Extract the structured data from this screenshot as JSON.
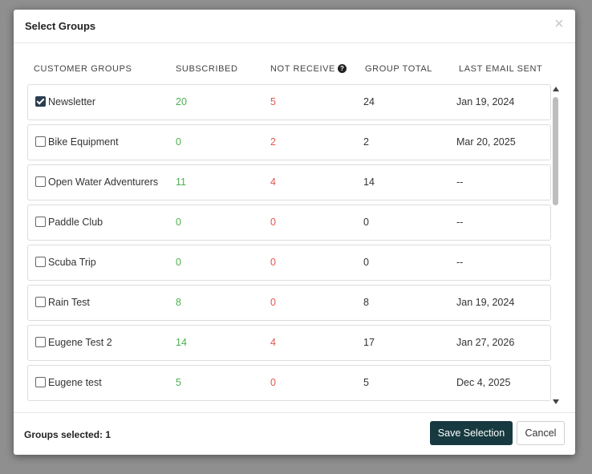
{
  "dialog": {
    "title": "Select Groups",
    "close_icon": "close-icon"
  },
  "columns": {
    "customer_groups": "CUSTOMER GROUPS",
    "subscribed": "SUBSCRIBED",
    "not_receive": "NOT RECEIVE",
    "not_receive_help": "?",
    "group_total": "GROUP TOTAL",
    "last_email_sent": "LAST EMAIL SENT"
  },
  "groups": [
    {
      "name": "Newsletter",
      "checked": true,
      "subscribed": "20",
      "not_receive": "5",
      "total": "24",
      "last_sent": "Jan 19, 2024"
    },
    {
      "name": "Bike Equipment",
      "checked": false,
      "subscribed": "0",
      "not_receive": "2",
      "total": "2",
      "last_sent": "Mar 20, 2025"
    },
    {
      "name": "Open Water Adventurers",
      "checked": false,
      "subscribed": "11",
      "not_receive": "4",
      "total": "14",
      "last_sent": "--"
    },
    {
      "name": "Paddle Club",
      "checked": false,
      "subscribed": "0",
      "not_receive": "0",
      "total": "0",
      "last_sent": "--"
    },
    {
      "name": "Scuba Trip",
      "checked": false,
      "subscribed": "0",
      "not_receive": "0",
      "total": "0",
      "last_sent": "--"
    },
    {
      "name": "Rain Test",
      "checked": false,
      "subscribed": "8",
      "not_receive": "0",
      "total": "8",
      "last_sent": "Jan 19, 2024"
    },
    {
      "name": "Eugene Test 2",
      "checked": false,
      "subscribed": "14",
      "not_receive": "4",
      "total": "17",
      "last_sent": "Jan 27, 2026"
    },
    {
      "name": "Eugene test",
      "checked": false,
      "subscribed": "5",
      "not_receive": "0",
      "total": "5",
      "last_sent": "Dec 4, 2025"
    }
  ],
  "footer": {
    "groups_selected": "Groups selected: 1",
    "save_label": "Save Selection",
    "cancel_label": "Cancel"
  },
  "colors": {
    "subscribed": "#4caf50",
    "not_receive": "#e0574f",
    "primary_button": "#173a40"
  }
}
